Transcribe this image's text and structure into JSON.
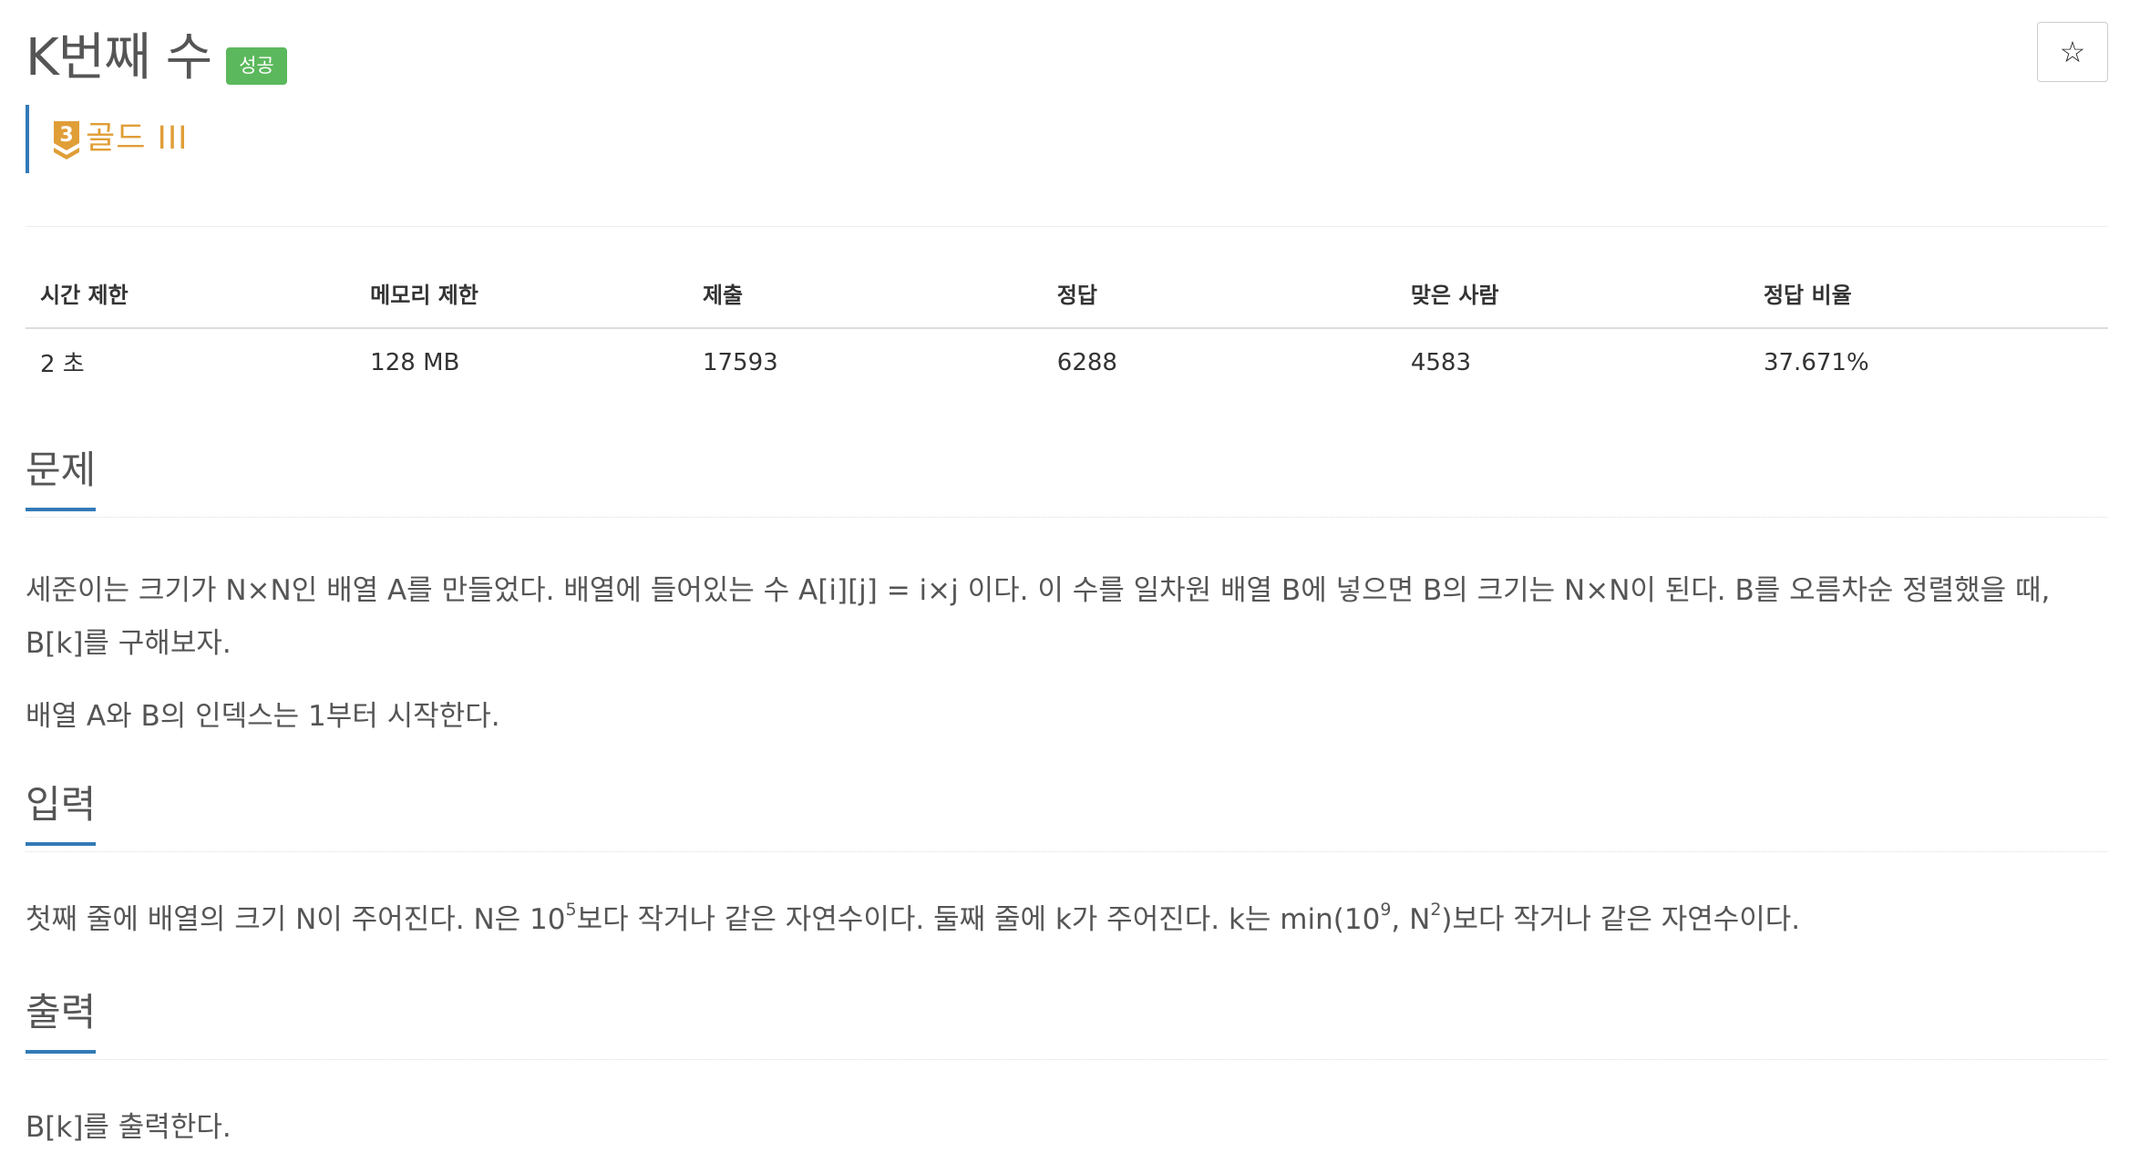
{
  "problem": {
    "title": "K번째 수",
    "status_badge": "성공",
    "tier": {
      "number": "3",
      "label": "골드 III",
      "color": "#e09e37"
    },
    "star_icon": "☆"
  },
  "stats": {
    "headers": [
      "시간 제한",
      "메모리 제한",
      "제출",
      "정답",
      "맞은 사람",
      "정답 비율"
    ],
    "values": [
      "2 초",
      "128 MB",
      "17593",
      "6288",
      "4583",
      "37.671%"
    ]
  },
  "sections": {
    "problem": {
      "title": "문제",
      "p1": "세준이는 크기가 N×N인 배열 A를 만들었다. 배열에 들어있는 수 A[i][j] = i×j 이다. 이 수를 일차원 배열 B에 넣으면 B의 크기는 N×N이 된다. B를 오름차순 정렬했을 때, B[k]를 구해보자.",
      "p2": "배열 A와 B의 인덱스는 1부터 시작한다."
    },
    "input": {
      "title": "입력",
      "a": "첫째 줄에 배열의 크기 N이 주어진다. N은 10",
      "sup1": "5",
      "b": "보다 작거나 같은 자연수이다. 둘째 줄에 k가 주어진다. k는 min(10",
      "sup2": "9",
      "c": ", N",
      "sup3": "2",
      "d": ")보다 작거나 같은 자연수이다."
    },
    "output": {
      "title": "출력",
      "text": "B[k]를 출력한다."
    }
  },
  "colors": {
    "accent": "#337ab7",
    "success": "#5cb85c",
    "gold": "#e09e37"
  }
}
